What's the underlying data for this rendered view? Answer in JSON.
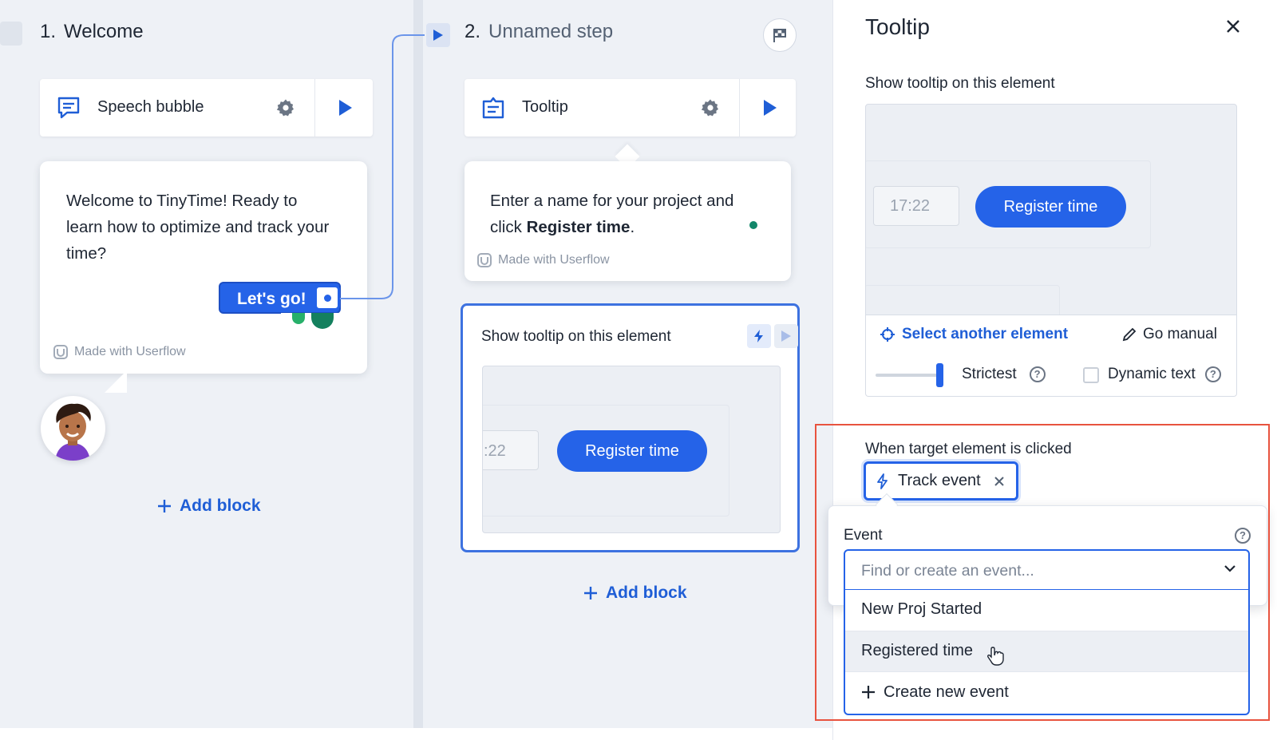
{
  "flow": {
    "step1": {
      "number": "1.",
      "title": "Welcome",
      "block": {
        "label": "Speech bubble"
      },
      "bubble_text": "Welcome to TinyTime! Ready to learn how to optimize and track your time?",
      "button_label": "Let's go!",
      "made_with": "Made with Userflow",
      "add_block": "Add block"
    },
    "step2": {
      "number": "2.",
      "title": "Unnamed step",
      "block": {
        "label": "Tooltip"
      },
      "tooltip_text_1": "Enter a name for your project and click ",
      "tooltip_text_bold": "Register time",
      "tooltip_text_2": ".",
      "made_with": "Made with Userflow",
      "target_card": {
        "title": "Show tooltip on this element",
        "preview_input": ":22",
        "preview_button": "Register time"
      },
      "add_block": "Add block"
    }
  },
  "panel": {
    "title": "Tooltip",
    "show_label": "Show tooltip on this element",
    "preview_input": "17:22",
    "preview_button": "Register time",
    "select_another": "Select another element",
    "go_manual": "Go manual",
    "strictness_label": "Strictest",
    "dynamic_text_label": "Dynamic text",
    "dynamic_text_checked": false,
    "clicked_label": "When target element is clicked",
    "action_chip": "Track event",
    "event_label": "Event",
    "event_placeholder": "Find or create an event...",
    "event_options": [
      "New Proj Started",
      "Registered time"
    ],
    "create_new": "Create new event"
  },
  "colors": {
    "accent": "#2563e8",
    "highlight_frame": "#e8533f",
    "canvas": "#eef1f6"
  }
}
